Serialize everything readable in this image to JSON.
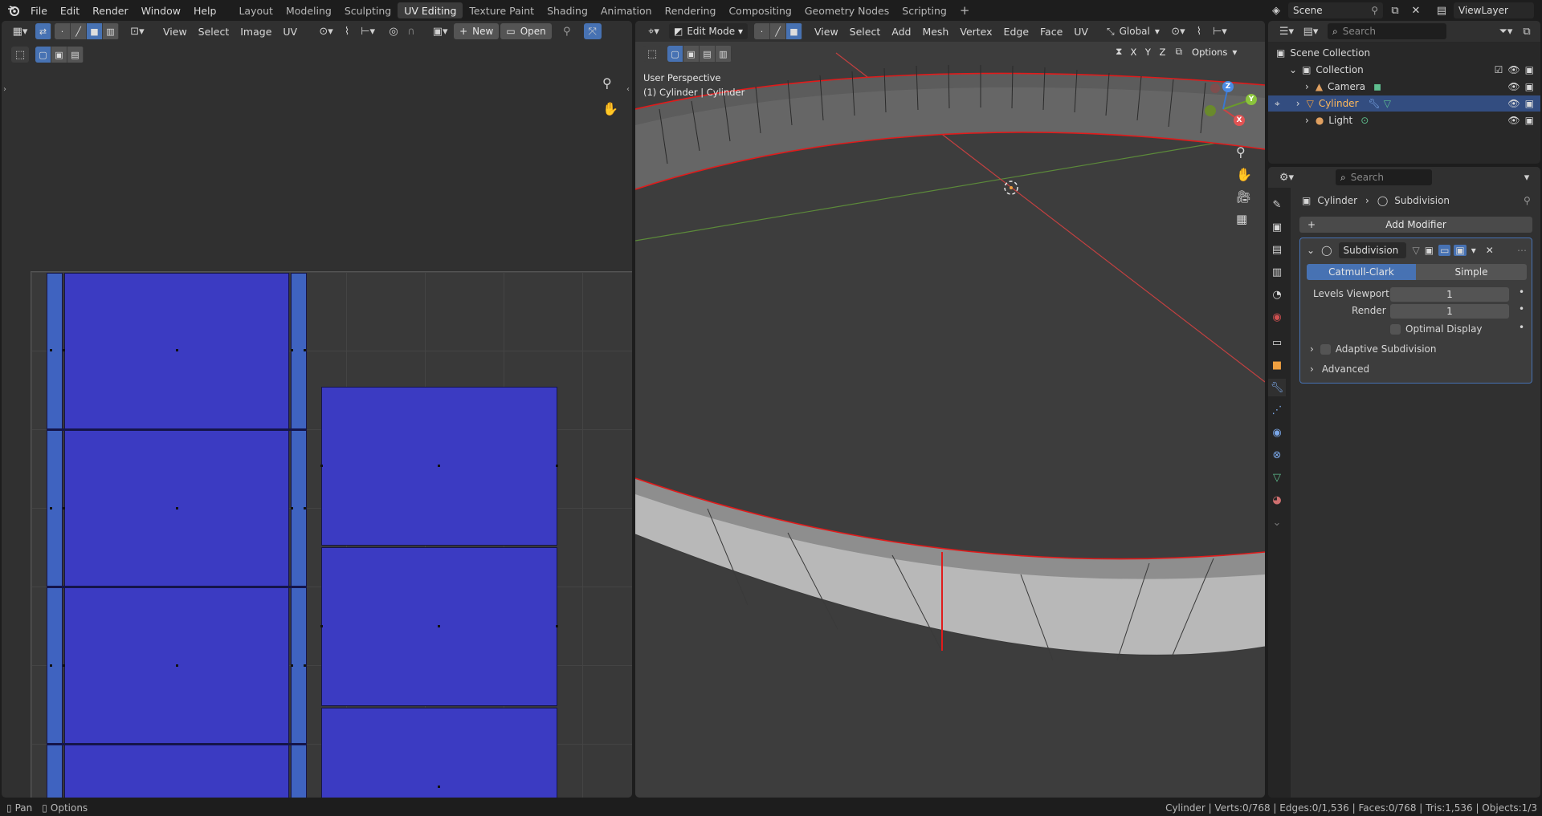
{
  "topbar": {
    "menus": [
      "File",
      "Edit",
      "Render",
      "Window",
      "Help"
    ],
    "workspaces": [
      "Layout",
      "Modeling",
      "Sculpting",
      "UV Editing",
      "Texture Paint",
      "Shading",
      "Animation",
      "Rendering",
      "Compositing",
      "Geometry Nodes",
      "Scripting"
    ],
    "active_workspace": "UV Editing",
    "add_tab": "+",
    "scene_label": "Scene",
    "viewlayer_label": "ViewLayer"
  },
  "uv_editor": {
    "menus": [
      "View",
      "Select",
      "Image",
      "UV"
    ],
    "new_label": "New",
    "open_label": "Open"
  },
  "viewport": {
    "mode": "Edit Mode",
    "menus": [
      "View",
      "Select",
      "Add",
      "Mesh",
      "Vertex",
      "Edge",
      "Face",
      "UV"
    ],
    "orientation": "Global",
    "axes": [
      "X",
      "Y",
      "Z"
    ],
    "options_label": "Options",
    "overlay_line1": "User Perspective",
    "overlay_line2": "(1) Cylinder | Cylinder",
    "gizmo": {
      "x": "X",
      "y": "Y",
      "z": "Z"
    }
  },
  "outliner": {
    "search_placeholder": "Search",
    "scene_collection": "Scene Collection",
    "collection": "Collection",
    "items": [
      {
        "label": "Camera",
        "selected": false
      },
      {
        "label": "Cylinder",
        "selected": true
      },
      {
        "label": "Light",
        "selected": false
      }
    ]
  },
  "properties": {
    "search_placeholder": "Search",
    "breadcrumb_object": "Cylinder",
    "breadcrumb_modifier": "Subdivision",
    "add_modifier": "Add Modifier",
    "modifier_name": "Subdivision",
    "type_options": [
      "Catmull-Clark",
      "Simple"
    ],
    "active_type": "Catmull-Clark",
    "levels_viewport_label": "Levels Viewport",
    "levels_viewport_value": "1",
    "render_label": "Render",
    "render_value": "1",
    "optimal_display_label": "Optimal Display",
    "adaptive_label": "Adaptive Subdivision",
    "advanced_label": "Advanced"
  },
  "status": {
    "pan_label": "Pan",
    "options_label": "Options",
    "stats": "Cylinder | Verts:0/768 | Edges:0/1,536 | Faces:0/768 | Tris:1,536 | Objects:1/3"
  },
  "colors": {
    "accent": "#4772b3",
    "uv_face": "#3b3bc2",
    "seam": "#e01b1b",
    "selected_row": "#334d80"
  }
}
